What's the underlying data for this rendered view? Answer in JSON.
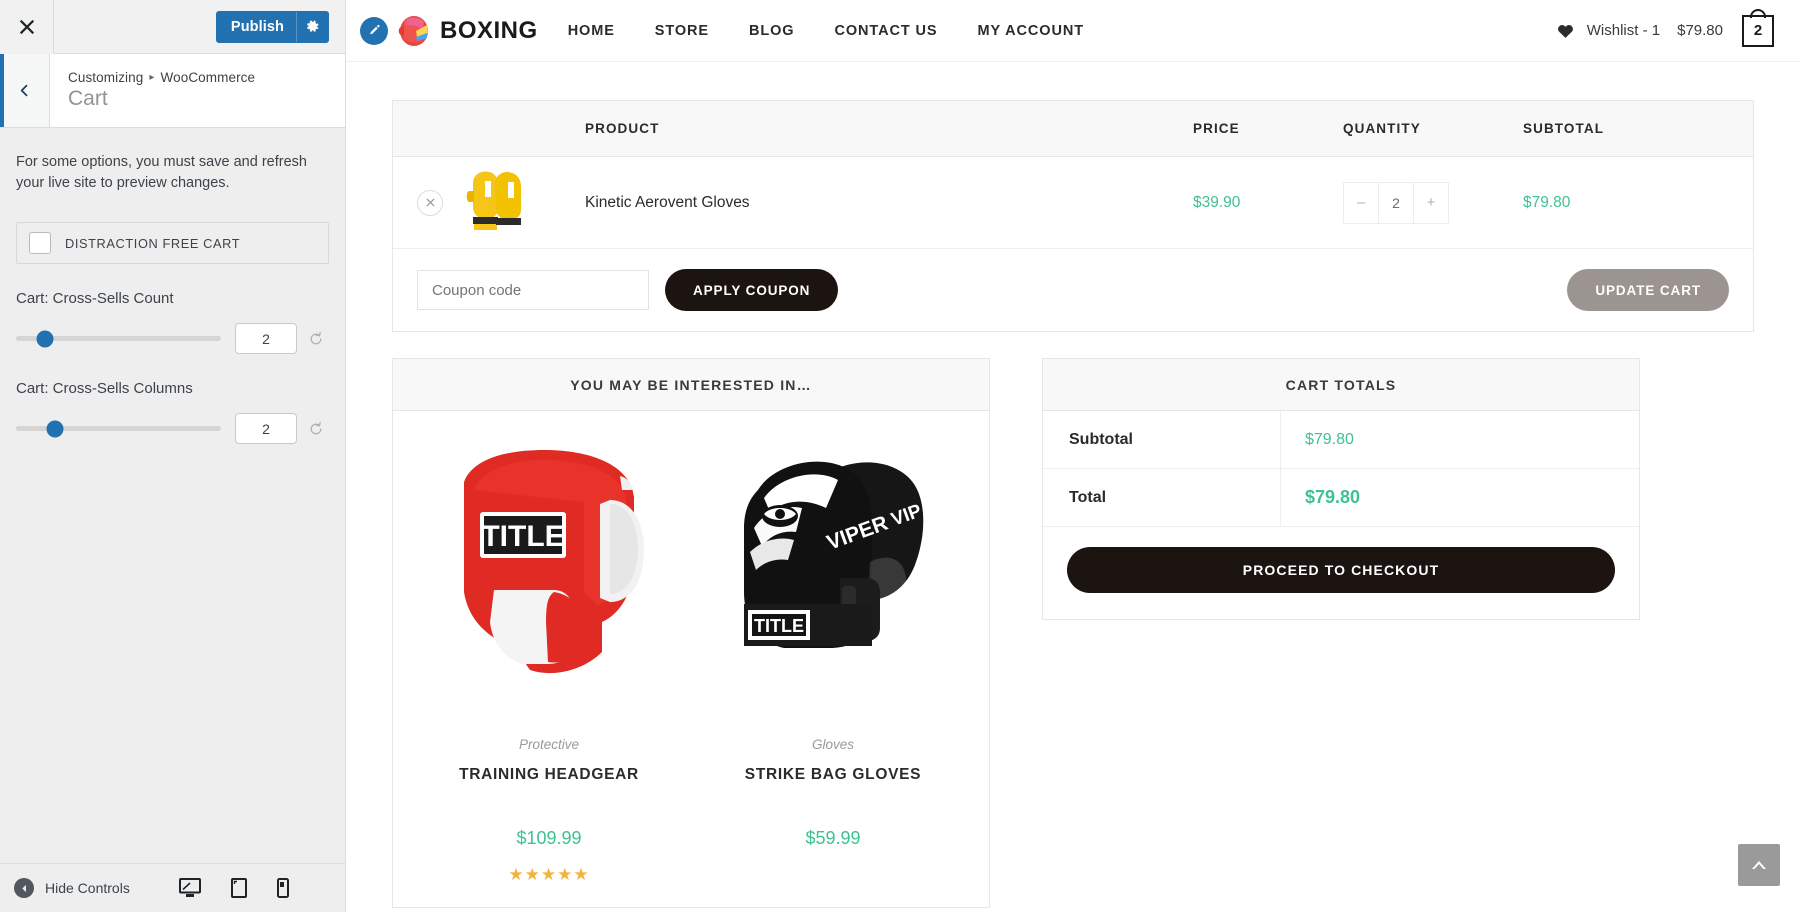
{
  "customizer": {
    "close_label": "Close",
    "publish_label": "Publish",
    "breadcrumb_root": "Customizing",
    "breadcrumb_sep": "▸",
    "breadcrumb_section": "WooCommerce",
    "panel_title": "Cart",
    "notice": "For some options, you must save and refresh your live site to preview changes.",
    "checkbox": {
      "label": "DISTRACTION FREE CART",
      "checked": false
    },
    "controls": [
      {
        "label": "Cart: Cross-Sells Count",
        "value": "2",
        "thumb_percent": 14
      },
      {
        "label": "Cart: Cross-Sells Columns",
        "value": "2",
        "thumb_percent": 19
      }
    ],
    "footer": {
      "hide_controls_label": "Hide Controls",
      "devices": [
        {
          "name": "desktop",
          "active": true
        },
        {
          "name": "tablet",
          "active": false
        },
        {
          "name": "mobile",
          "active": false
        }
      ]
    },
    "accent_color": "#2271b1"
  },
  "site": {
    "edit_icon": "pencil-icon",
    "logo_icon": "boxing-glove-logo",
    "brand": "BOXING",
    "nav": [
      {
        "label": "HOME"
      },
      {
        "label": "STORE"
      },
      {
        "label": "BLOG"
      },
      {
        "label": "CONTACT US"
      },
      {
        "label": "MY ACCOUNT"
      }
    ],
    "header_right": {
      "wishlist_icon": "heart-icon",
      "wishlist_label": "Wishlist - 1",
      "cart_amount": "$79.80",
      "cart_count": "2"
    }
  },
  "cart": {
    "columns": {
      "product": "PRODUCT",
      "price": "PRICE",
      "quantity": "QUANTITY",
      "subtotal": "SUBTOTAL"
    },
    "items": [
      {
        "remove_icon": "close-icon",
        "thumb": "yellow-boxing-gloves",
        "name": "Kinetic Aerovent Gloves",
        "price": "$39.90",
        "qty_minus": "–",
        "qty": "2",
        "qty_plus": "+",
        "subtotal": "$79.80"
      }
    ],
    "coupon": {
      "placeholder": "Coupon code",
      "value": "",
      "apply_label": "APPLY COUPON"
    },
    "update_label": "UPDATE CART"
  },
  "crosssells": {
    "heading": "YOU MAY BE INTERESTED IN…",
    "products": [
      {
        "image": "red-title-headgear",
        "category": "Protective",
        "title": "TRAINING HEADGEAR",
        "price": "$109.99",
        "stars": "★★★★★"
      },
      {
        "image": "black-viper-gloves",
        "category": "Gloves",
        "title": "STRIKE BAG GLOVES",
        "price": "$59.99",
        "stars": ""
      }
    ]
  },
  "totals": {
    "heading": "CART TOTALS",
    "rows": [
      {
        "label": "Subtotal",
        "value": "$79.80"
      },
      {
        "label": "Total",
        "value": "$79.80"
      }
    ],
    "checkout_label": "PROCEED TO CHECKOUT",
    "price_color": "#3ec28f"
  },
  "scroll_top_icon": "chevron-up-icon"
}
